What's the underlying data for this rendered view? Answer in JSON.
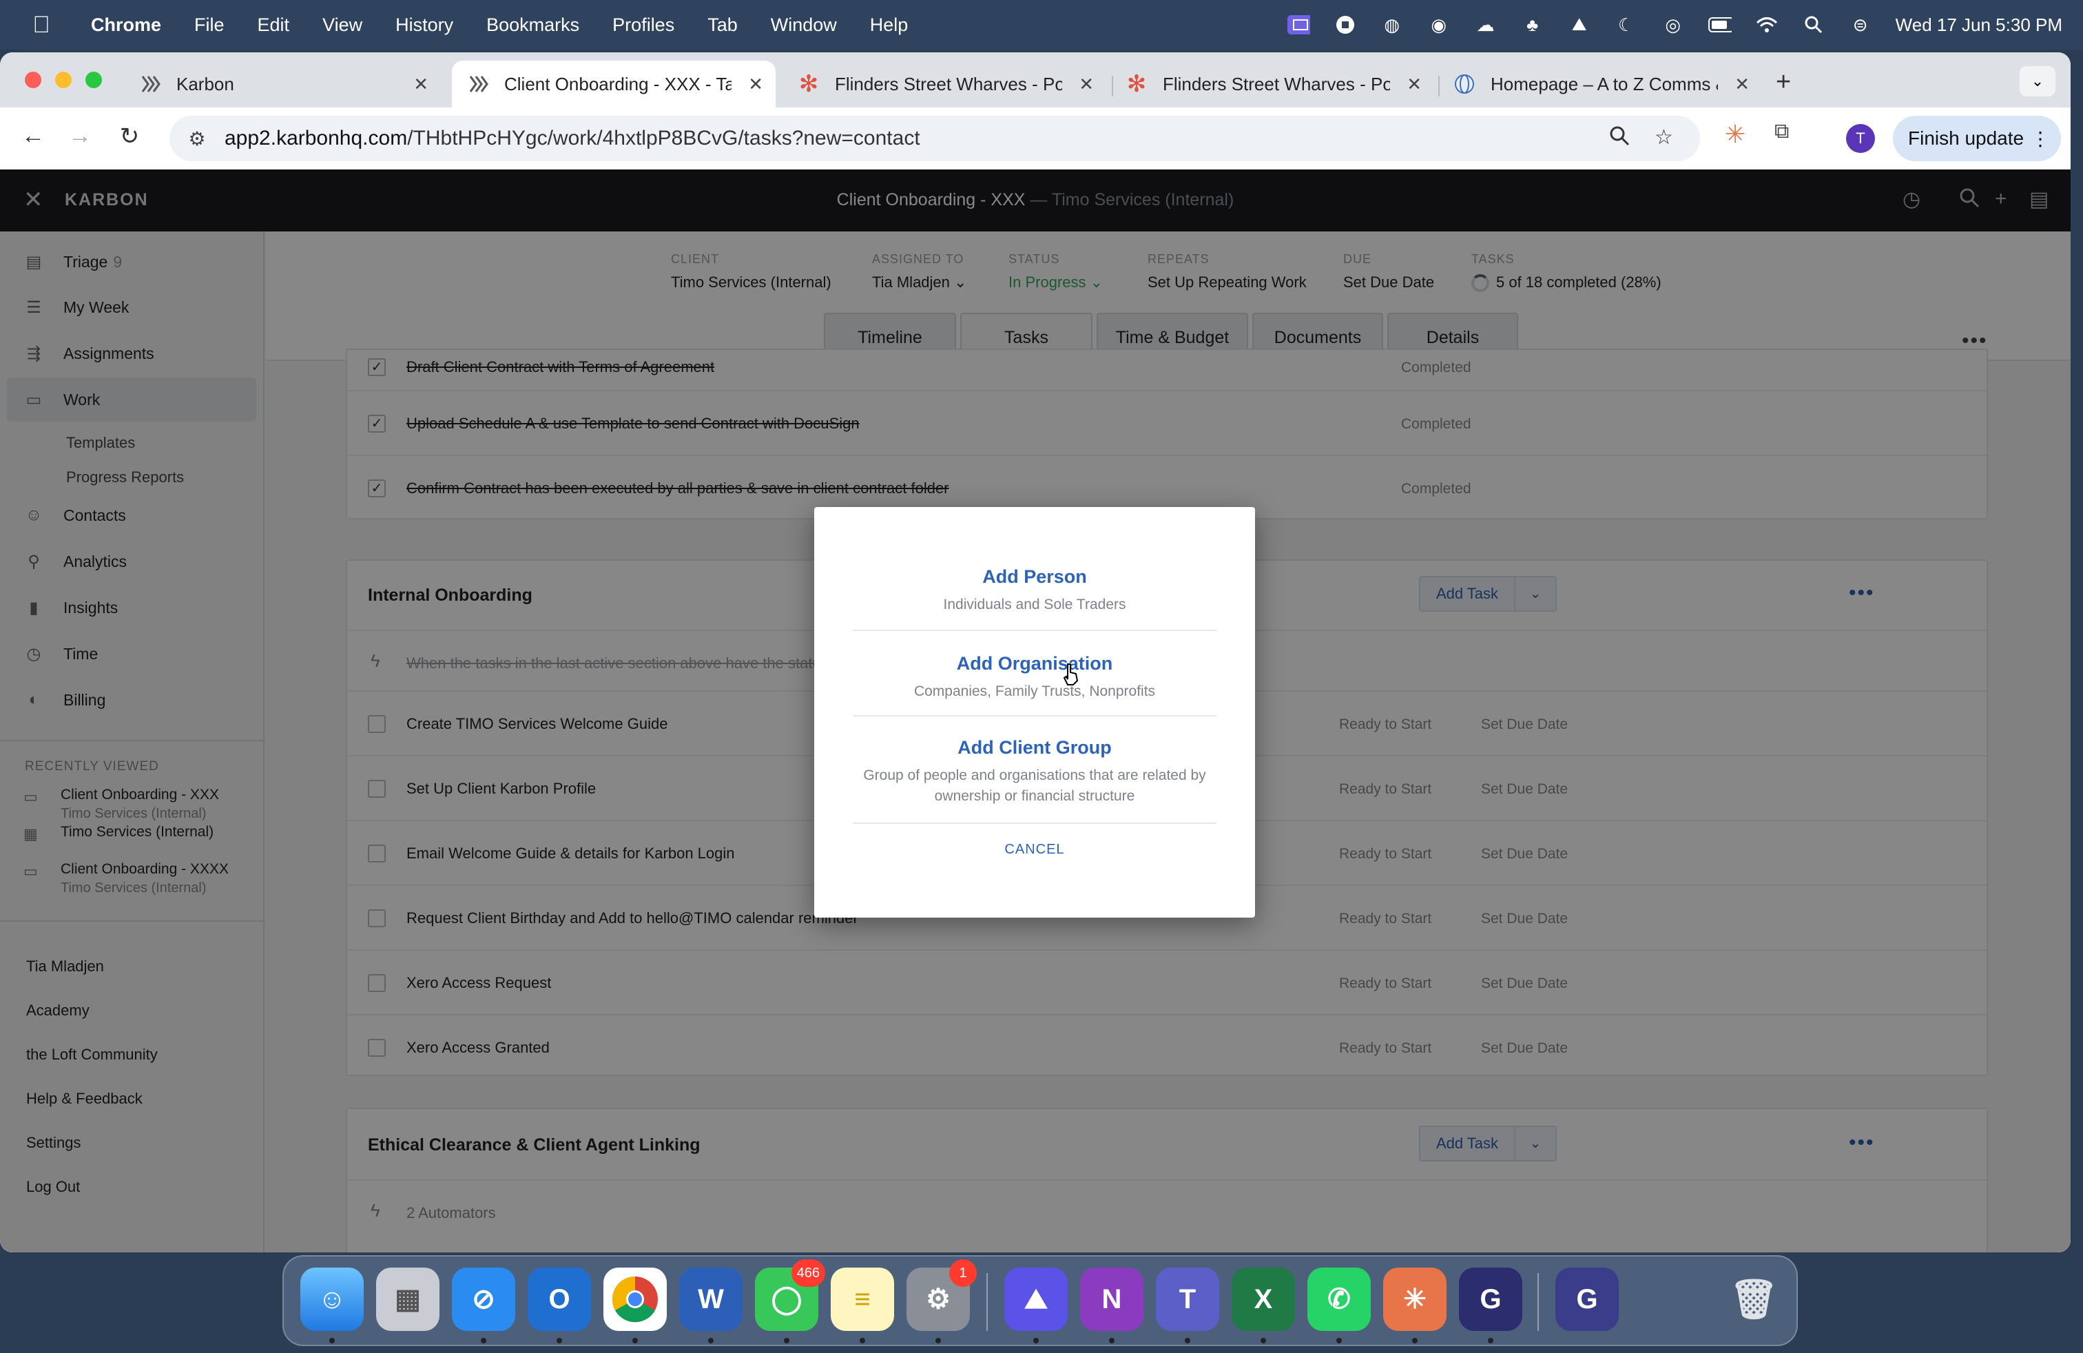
{
  "menubar": {
    "app_name": "Chrome",
    "items": [
      "File",
      "Edit",
      "View",
      "History",
      "Bookmarks",
      "Profiles",
      "Tab",
      "Window",
      "Help"
    ],
    "clock": "Wed 17 Jun  5:30 PM"
  },
  "browser": {
    "tabs": [
      {
        "title": "Karbon",
        "favicon": "karbon-icon"
      },
      {
        "title": "Client Onboarding - XXX - Ta",
        "favicon": "karbon-icon"
      },
      {
        "title": "Flinders Street Wharves - Po",
        "favicon": "asterisk-icon"
      },
      {
        "title": "Flinders Street Wharves - Po",
        "favicon": "asterisk-icon"
      },
      {
        "title": "Homepage – A to Z Comms &",
        "favicon": "globe-icon"
      }
    ],
    "url_host": "app2.karbonhq.com",
    "url_path": "/THbtHPcHYgc/work/4hxtlpP8BCvG/tasks?new=contact",
    "profile_initial": "T",
    "finish_update": "Finish update"
  },
  "app": {
    "brand": "KARBON",
    "window_title": "Client Onboarding - XXX",
    "window_subtitle": "— Timo Services (Internal)"
  },
  "sidebar": {
    "items": [
      {
        "label": "Triage",
        "badge": "9",
        "icon": "triage-icon"
      },
      {
        "label": "My Week",
        "icon": "list-icon"
      },
      {
        "label": "Assignments",
        "icon": "assign-icon"
      },
      {
        "label": "Work",
        "icon": "briefcase-icon"
      },
      {
        "label": "Contacts",
        "icon": "contacts-icon"
      },
      {
        "label": "Analytics",
        "icon": "analytics-icon"
      },
      {
        "label": "Insights",
        "icon": "insights-icon"
      },
      {
        "label": "Time",
        "icon": "clock-icon"
      },
      {
        "label": "Billing",
        "icon": "billing-icon"
      }
    ],
    "work_subitems": [
      "Templates",
      "Progress Reports"
    ],
    "recently_viewed_heading": "RECENTLY VIEWED",
    "recent": [
      {
        "title": "Client Onboarding - XXX",
        "sub": "Timo Services (Internal)"
      },
      {
        "title": "Timo Services (Internal)",
        "sub": ""
      },
      {
        "title": "Client Onboarding - XXXX",
        "sub": "Timo Services (Internal)"
      }
    ],
    "footer": [
      "Tia Mladjen",
      "Academy",
      "the Loft Community",
      "Help & Feedback",
      "Settings",
      "Log Out"
    ]
  },
  "work": {
    "meta": [
      {
        "label": "CLIENT",
        "value": "Timo Services (Internal)"
      },
      {
        "label": "ASSIGNED TO",
        "value": "Tia Mladjen ⌄"
      },
      {
        "label": "STATUS",
        "value": "In Progress ⌄"
      },
      {
        "label": "REPEATS",
        "value": "Set Up Repeating Work"
      },
      {
        "label": "DUE",
        "value": "Set Due Date"
      },
      {
        "label": "TASKS",
        "value": "5 of 18 completed (28%)"
      }
    ],
    "tabs": [
      "Timeline",
      "Tasks",
      "Time & Budget",
      "Documents",
      "Details"
    ],
    "completed_tasks": [
      {
        "name": "Draft Client Contract with Terms of Agreement",
        "status": "Completed"
      },
      {
        "name": "Upload Schedule A & use Template to send Contract with DocuSign",
        "status": "Completed"
      },
      {
        "name": "Confirm Contract has been executed by all parties & save in client contract folder",
        "status": "Completed"
      }
    ],
    "sections": [
      {
        "title": "Internal Onboarding",
        "add_task": "Add Task",
        "automator": "When the tasks in the last active section above have the status ... , change the status of this section to 'Ready to Start'",
        "tasks": [
          {
            "name": "Create TIMO Services Welcome Guide",
            "status": "Ready to Start",
            "due": "Set Due Date"
          },
          {
            "name": "Set Up Client Karbon Profile",
            "status": "Ready to Start",
            "due": "Set Due Date"
          },
          {
            "name": "Email Welcome Guide & details for Karbon Login",
            "status": "Ready to Start",
            "due": "Set Due Date"
          },
          {
            "name": "Request Client Birthday and Add to hello@TIMO calendar reminder",
            "status": "Ready to Start",
            "due": "Set Due Date"
          },
          {
            "name": "Xero Access Request",
            "status": "Ready to Start",
            "due": "Set Due Date"
          },
          {
            "name": "Xero Access Granted",
            "status": "Ready to Start",
            "due": "Set Due Date"
          }
        ]
      },
      {
        "title": "Ethical Clearance & Client Agent Linking",
        "add_task": "Add Task",
        "automators": "2 Automators"
      }
    ]
  },
  "modal": {
    "options": [
      {
        "title": "Add Person",
        "desc": "Individuals and Sole Traders"
      },
      {
        "title": "Add Organisation",
        "desc": "Companies, Family Trusts, Nonprofits"
      },
      {
        "title": "Add Client Group",
        "desc": "Group of people and organisations that are related by ownership or financial structure"
      }
    ],
    "cancel": "CANCEL"
  },
  "dock": {
    "apps": [
      "Finder",
      "Launchpad",
      "Safari",
      "Outlook",
      "Chrome",
      "Word",
      "Messages",
      "Notes",
      "System Settings",
      "Proton VPN",
      "OneNote",
      "Teams",
      "Excel",
      "WhatsApp",
      "Claude",
      "Grammarly",
      "Grammarly Desktop",
      "Trash"
    ],
    "messages_badge": "466",
    "settings_badge": "1"
  },
  "colors": {
    "accent": "#2c63b8",
    "status_green": "#3aa35a",
    "header_dark": "#1b1c1f"
  }
}
